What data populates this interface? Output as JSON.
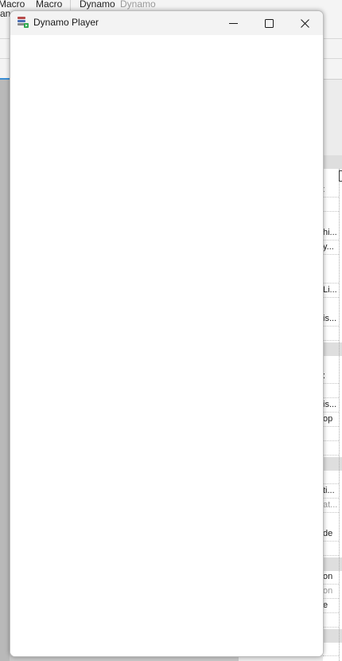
{
  "ribbon": {
    "tabs": [
      {
        "label": "Macro",
        "dim": false
      },
      {
        "label": "Macro",
        "dim": false
      },
      {
        "label": "Dynamo",
        "dim": false
      },
      {
        "label": "Dynamo",
        "dim": true
      }
    ],
    "row2_fragment": "an"
  },
  "properties": {
    "rows": [
      {
        "text": ":",
        "gray": true
      },
      {
        "text": "",
        "gray": false
      },
      {
        "text": "hi...",
        "gray": false
      },
      {
        "text": "y...",
        "gray": false
      },
      {
        "text": "",
        "gray": false
      },
      {
        "text": "Li...",
        "gray": false
      },
      {
        "text": "is...",
        "gray": false
      },
      {
        "text": "",
        "gray": false
      },
      {
        "text": ":",
        "gray": false
      },
      {
        "text": "",
        "gray": false
      },
      {
        "text": "is...",
        "gray": false
      },
      {
        "text": "op",
        "gray": false
      },
      {
        "text": "",
        "gray": false
      },
      {
        "text": "",
        "gray": false
      },
      {
        "text": "",
        "gray": false
      },
      {
        "text": "ti...",
        "gray": false
      },
      {
        "text": "at...",
        "gray": true
      },
      {
        "text": "de",
        "gray": false
      },
      {
        "text": "",
        "gray": false
      },
      {
        "text": "on",
        "gray": false
      },
      {
        "text": "on",
        "gray": true
      },
      {
        "text": "e",
        "gray": false
      },
      {
        "text": "",
        "gray": false
      },
      {
        "text": "",
        "gray": false
      }
    ]
  },
  "window": {
    "title": "Dynamo Player",
    "app_icon": "dynamo-player-icon",
    "buttons": {
      "minimize": "minimize-icon",
      "maximize": "maximize-icon",
      "close": "close-icon"
    }
  },
  "colors": {
    "titlebar": "#f3f3f3",
    "content": "#ffffff",
    "accent": "#3b8fd6"
  }
}
